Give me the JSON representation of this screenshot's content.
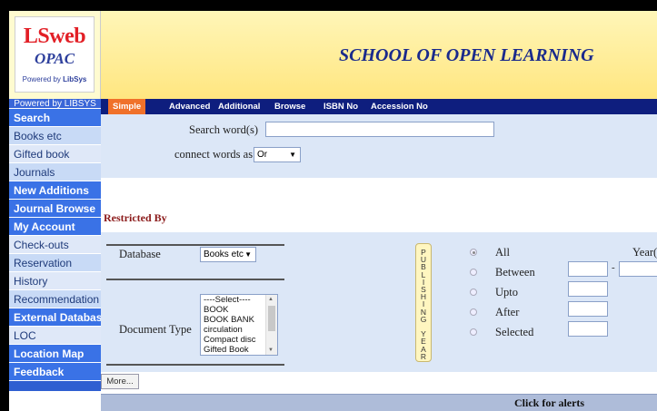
{
  "logo": {
    "main": "LSweb",
    "sub": "OPAC",
    "powered_prefix": "Powered by ",
    "powered_brand": "LibSys"
  },
  "header": {
    "title": "SCHOOL OF OPEN LEARNING"
  },
  "sidebar": {
    "powered": "Powered by LIBSYS",
    "items": [
      {
        "label": "Search",
        "type": "head"
      },
      {
        "label": "Books etc",
        "type": "link"
      },
      {
        "label": "Gifted book",
        "type": "link"
      },
      {
        "label": "Journals",
        "type": "link"
      },
      {
        "label": "New Additions",
        "type": "head"
      },
      {
        "label": "Journal Browse",
        "type": "head"
      },
      {
        "label": "My Account",
        "type": "head"
      },
      {
        "label": "Check-outs",
        "type": "link"
      },
      {
        "label": "Reservation",
        "type": "link"
      },
      {
        "label": "History",
        "type": "link"
      },
      {
        "label": "Recommendation",
        "type": "link"
      },
      {
        "label": "External Database",
        "type": "head"
      },
      {
        "label": "LOC",
        "type": "link"
      },
      {
        "label": "Location Map",
        "type": "head"
      },
      {
        "label": "Feedback",
        "type": "head"
      }
    ]
  },
  "tabs": [
    "Simple",
    "Advanced",
    "Additional",
    "Browse",
    "ISBN No",
    "Accession No"
  ],
  "search": {
    "search_words_label": "Search word(s)",
    "search_words_value": "",
    "connect_label": "connect words as",
    "connect_value": "Or"
  },
  "restricted": {
    "heading": "Restricted By",
    "database_label": "Database",
    "database_value": "Books etc",
    "doc_type_label": "Document Type",
    "doc_type_options": [
      "----Select----",
      "BOOK",
      "BOOK BANK",
      "circulation",
      "Compact disc",
      "Gifted Book"
    ],
    "pub_year_letters": [
      "P",
      "U",
      "B",
      "L",
      "I",
      "S",
      "H",
      "I",
      "N",
      "G",
      "",
      "Y",
      "E",
      "A",
      "R"
    ],
    "year_options": [
      {
        "label": "All",
        "selected": true
      },
      {
        "label": "Between",
        "selected": false
      },
      {
        "label": "Upto",
        "selected": false
      },
      {
        "label": "After",
        "selected": false
      },
      {
        "label": "Selected",
        "selected": false
      }
    ],
    "year_label": "Year(s)",
    "between_sep": "-"
  },
  "more_label": "More...",
  "alert_label": "Click for alerts",
  "colors": {
    "accent_tab": "#f0712a",
    "tabbar": "#0e1e7e",
    "panel": "#dce7f7",
    "sidebar_head": "#3a72e6"
  }
}
